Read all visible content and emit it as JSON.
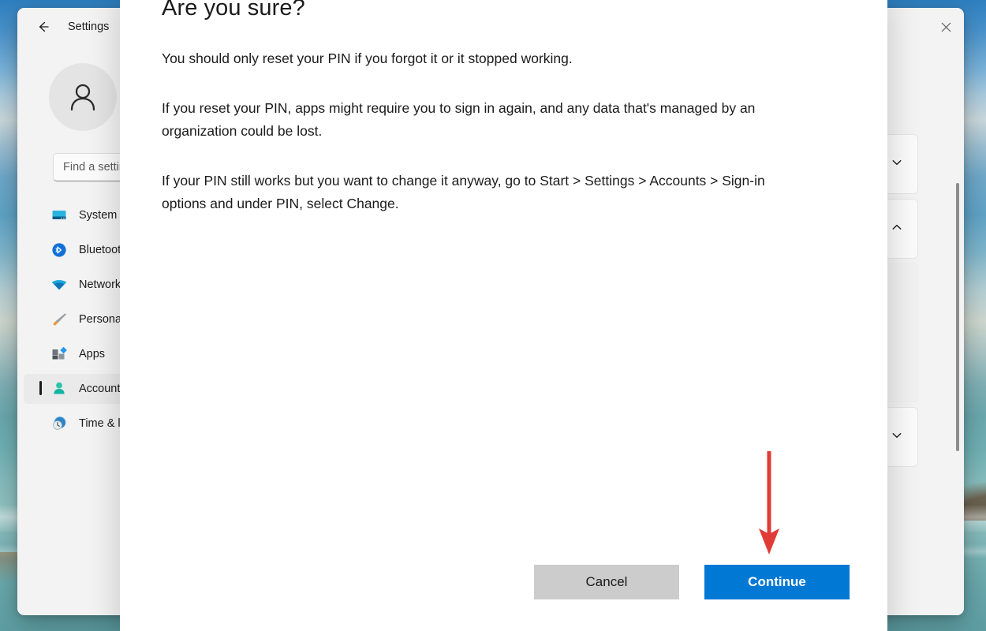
{
  "desktop": {
    "wallpaper_description": "beach-ocean-wallpaper",
    "sky_color": "#4a93cc",
    "sea_color": "#6aa9ad"
  },
  "settings_window": {
    "title": "Settings",
    "back_button_label": "Back",
    "close_button_label": "Close",
    "account": {
      "avatar_icon": "person-avatar-icon"
    },
    "search": {
      "placeholder": "Find a setting",
      "value": ""
    },
    "nav_items": [
      {
        "label": "System",
        "icon": "system-display-icon",
        "selected": false
      },
      {
        "label": "Bluetooth",
        "icon": "bluetooth-icon",
        "selected": false
      },
      {
        "label": "Network",
        "icon": "network-wifi-icon",
        "selected": false
      },
      {
        "label": "Personalization",
        "icon": "personalization-brush-icon",
        "selected": false
      },
      {
        "label": "Apps",
        "icon": "apps-icon",
        "selected": false
      },
      {
        "label": "Accounts",
        "icon": "accounts-person-icon",
        "selected": true
      },
      {
        "label": "Time & language",
        "icon": "time-language-icon",
        "selected": false
      }
    ],
    "cards": [
      {
        "chevron": "chevron-down",
        "expanded": false
      },
      {
        "chevron": "chevron-up",
        "expanded": true
      },
      {
        "chevron": "",
        "expanded": false
      },
      {
        "chevron": "chevron-down",
        "expanded": false
      }
    ],
    "scrollbar_visible": true
  },
  "dialog": {
    "title": "Are you sure?",
    "paragraphs": [
      "You should only reset your PIN if you forgot it or it stopped working.",
      "If you reset your PIN, apps might require you to sign in again, and any data that's managed by an organization could be lost.",
      "If your PIN still works but you want to change it anyway, go to Start > Settings > Accounts > Sign-in options and under PIN, select Change."
    ],
    "cancel_label": "Cancel",
    "continue_label": "Continue",
    "primary_color": "#0078d4",
    "cancel_color": "#cccccc"
  },
  "annotation": {
    "arrow_color": "#e03b36",
    "arrow_target": "continue-button",
    "arrow_direction": "down"
  }
}
